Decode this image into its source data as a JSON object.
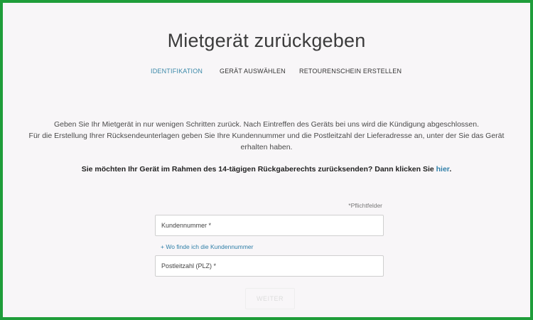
{
  "page": {
    "title": "Mietgerät zurückgeben"
  },
  "steps": [
    {
      "label": "IDENTIFIKATION",
      "active": true
    },
    {
      "label": "GERÄT AUSWÄHLEN",
      "active": false
    },
    {
      "label": "RETOURENSCHEIN ERSTELLEN",
      "active": false
    }
  ],
  "intro": {
    "line1": "Geben Sie Ihr Mietgerät in nur wenigen Schritten zurück. Nach Eintreffen des Geräts bei uns wird die Kündigung abgeschlossen.",
    "line2": "Für die Erstellung Ihrer Rücksendeunterlagen geben Sie Ihre Kundennummer und die Postleitzahl der Lieferadresse an, unter der Sie das Gerät",
    "line3": "erhalten haben."
  },
  "return_note": {
    "text": "Sie möchten Ihr Gerät im Rahmen des 14-tägigen Rückgaberechts zurücksenden? Dann klicken Sie ",
    "link": "hier",
    "suffix": "."
  },
  "form": {
    "required_note": "*Pflichtfelder",
    "customer_number_placeholder": "Kundennummer *",
    "help_link": "+ Wo finde ich die Kundennummer",
    "postcode_placeholder": "Postleitzahl (PLZ) *",
    "next_label": "WEITER"
  },
  "colors": {
    "frame_border": "#1f9d3a",
    "accent": "#3a88a8",
    "background": "#f8f6f8"
  }
}
